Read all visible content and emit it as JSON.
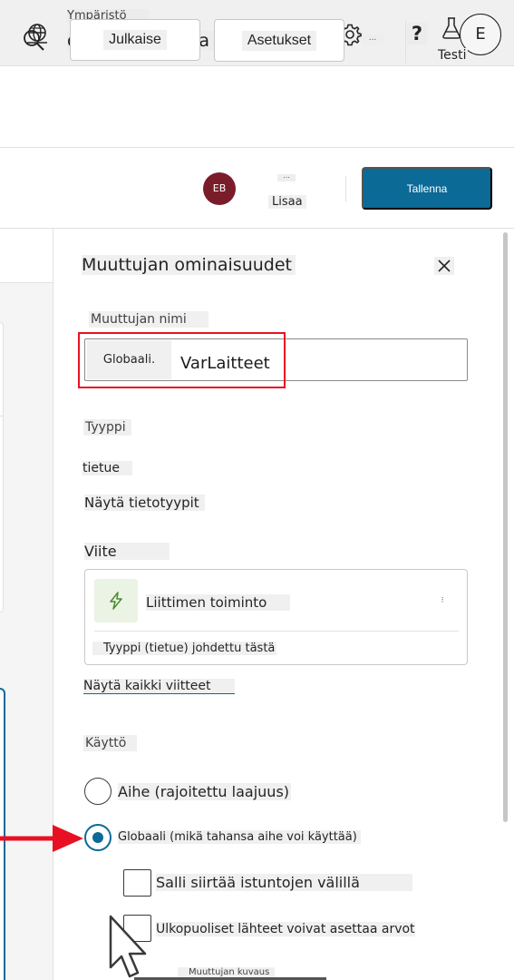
{
  "header": {
    "env_label": "Ympäristö",
    "env_name": "dev-cs-akatemia",
    "help_glyph": "?",
    "user_initial": "E",
    "icons": [
      "globe-icon",
      "gear-icon",
      "help-icon"
    ]
  },
  "commandbar": {
    "publish_label": "Julkaise",
    "settings_label": "Asetukset",
    "more_glyph": "...",
    "test_label": "Testi",
    "icons": [
      "search-icon",
      "flask-icon"
    ]
  },
  "savebar": {
    "user_avatar": "EB",
    "more_glyph": "...",
    "more_label": "Lisaa",
    "save_label": "Tallenna",
    "save_color": "#0b6a96"
  },
  "panel": {
    "title": "Muuttujan ominaisuudet",
    "variable_name_label": "Muuttujan nimi",
    "scope_prefix": "Globaali.",
    "variable_name_value": "VarLaitteet",
    "type_label": "Tyyppi",
    "type_value": "tietue",
    "show_data_types": "Näytä tietotyypit",
    "reference_label": "Viite",
    "reference_card": {
      "title": "Liittimen toiminto",
      "menu_glyph": "⁝",
      "note": "Tyyppi (tietue) johdettu tästä",
      "icon": "lightning-icon"
    },
    "show_all_references": "Näytä kaikki viitteet",
    "usage_label": "Käyttö",
    "usage_options": [
      {
        "label": "Aihe (rajoitettu laajuus)",
        "selected": false
      },
      {
        "label": "Globaali (mikä tahansa aihe voi käyttää)",
        "selected": true
      }
    ],
    "global_options": [
      {
        "label": "Salli siirtää istuntojen välillä",
        "checked": false
      },
      {
        "label": "Ulkopuoliset lähteet voivat asettaa arvot",
        "checked": false
      }
    ],
    "description_label": "Muuttujan kuvaus"
  },
  "annotation": {
    "highlight_color": "#e81123",
    "arrow_color": "#e81123"
  }
}
